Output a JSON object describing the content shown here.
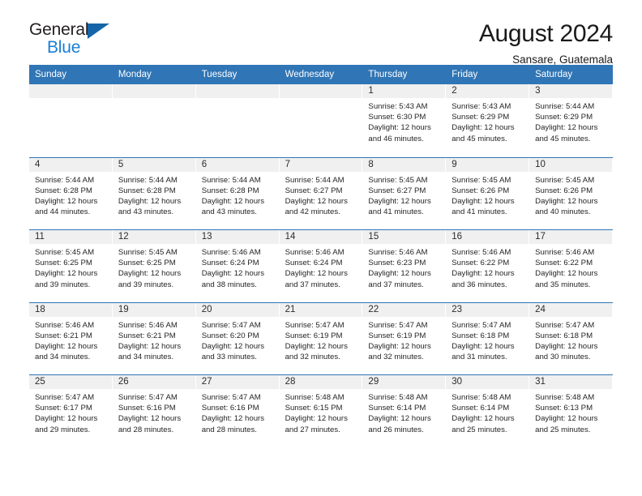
{
  "brand": {
    "name_top": "General",
    "name_bottom": "Blue",
    "accent_color": "#1b7fd4",
    "triangle_color": "#1565a8"
  },
  "header": {
    "title": "August 2024",
    "subtitle": "Sansare, Guatemala"
  },
  "theme": {
    "header_blue": "#3075b5",
    "date_strip_gray": "#f0f0f0",
    "text_color": "#252525"
  },
  "weekdays": [
    "Sunday",
    "Monday",
    "Tuesday",
    "Wednesday",
    "Thursday",
    "Friday",
    "Saturday"
  ],
  "labels": {
    "sunrise": "Sunrise:",
    "sunset": "Sunset:",
    "daylight": "Daylight:"
  },
  "weeks": [
    [
      {
        "day": "",
        "empty": true
      },
      {
        "day": "",
        "empty": true
      },
      {
        "day": "",
        "empty": true
      },
      {
        "day": "",
        "empty": true
      },
      {
        "day": "1",
        "sunrise": "Sunrise: 5:43 AM",
        "sunset": "Sunset: 6:30 PM",
        "daylight_1": "Daylight: 12 hours",
        "daylight_2": "and 46 minutes."
      },
      {
        "day": "2",
        "sunrise": "Sunrise: 5:43 AM",
        "sunset": "Sunset: 6:29 PM",
        "daylight_1": "Daylight: 12 hours",
        "daylight_2": "and 45 minutes."
      },
      {
        "day": "3",
        "sunrise": "Sunrise: 5:44 AM",
        "sunset": "Sunset: 6:29 PM",
        "daylight_1": "Daylight: 12 hours",
        "daylight_2": "and 45 minutes."
      }
    ],
    [
      {
        "day": "4",
        "sunrise": "Sunrise: 5:44 AM",
        "sunset": "Sunset: 6:28 PM",
        "daylight_1": "Daylight: 12 hours",
        "daylight_2": "and 44 minutes."
      },
      {
        "day": "5",
        "sunrise": "Sunrise: 5:44 AM",
        "sunset": "Sunset: 6:28 PM",
        "daylight_1": "Daylight: 12 hours",
        "daylight_2": "and 43 minutes."
      },
      {
        "day": "6",
        "sunrise": "Sunrise: 5:44 AM",
        "sunset": "Sunset: 6:28 PM",
        "daylight_1": "Daylight: 12 hours",
        "daylight_2": "and 43 minutes."
      },
      {
        "day": "7",
        "sunrise": "Sunrise: 5:44 AM",
        "sunset": "Sunset: 6:27 PM",
        "daylight_1": "Daylight: 12 hours",
        "daylight_2": "and 42 minutes."
      },
      {
        "day": "8",
        "sunrise": "Sunrise: 5:45 AM",
        "sunset": "Sunset: 6:27 PM",
        "daylight_1": "Daylight: 12 hours",
        "daylight_2": "and 41 minutes."
      },
      {
        "day": "9",
        "sunrise": "Sunrise: 5:45 AM",
        "sunset": "Sunset: 6:26 PM",
        "daylight_1": "Daylight: 12 hours",
        "daylight_2": "and 41 minutes."
      },
      {
        "day": "10",
        "sunrise": "Sunrise: 5:45 AM",
        "sunset": "Sunset: 6:26 PM",
        "daylight_1": "Daylight: 12 hours",
        "daylight_2": "and 40 minutes."
      }
    ],
    [
      {
        "day": "11",
        "sunrise": "Sunrise: 5:45 AM",
        "sunset": "Sunset: 6:25 PM",
        "daylight_1": "Daylight: 12 hours",
        "daylight_2": "and 39 minutes."
      },
      {
        "day": "12",
        "sunrise": "Sunrise: 5:45 AM",
        "sunset": "Sunset: 6:25 PM",
        "daylight_1": "Daylight: 12 hours",
        "daylight_2": "and 39 minutes."
      },
      {
        "day": "13",
        "sunrise": "Sunrise: 5:46 AM",
        "sunset": "Sunset: 6:24 PM",
        "daylight_1": "Daylight: 12 hours",
        "daylight_2": "and 38 minutes."
      },
      {
        "day": "14",
        "sunrise": "Sunrise: 5:46 AM",
        "sunset": "Sunset: 6:24 PM",
        "daylight_1": "Daylight: 12 hours",
        "daylight_2": "and 37 minutes."
      },
      {
        "day": "15",
        "sunrise": "Sunrise: 5:46 AM",
        "sunset": "Sunset: 6:23 PM",
        "daylight_1": "Daylight: 12 hours",
        "daylight_2": "and 37 minutes."
      },
      {
        "day": "16",
        "sunrise": "Sunrise: 5:46 AM",
        "sunset": "Sunset: 6:22 PM",
        "daylight_1": "Daylight: 12 hours",
        "daylight_2": "and 36 minutes."
      },
      {
        "day": "17",
        "sunrise": "Sunrise: 5:46 AM",
        "sunset": "Sunset: 6:22 PM",
        "daylight_1": "Daylight: 12 hours",
        "daylight_2": "and 35 minutes."
      }
    ],
    [
      {
        "day": "18",
        "sunrise": "Sunrise: 5:46 AM",
        "sunset": "Sunset: 6:21 PM",
        "daylight_1": "Daylight: 12 hours",
        "daylight_2": "and 34 minutes."
      },
      {
        "day": "19",
        "sunrise": "Sunrise: 5:46 AM",
        "sunset": "Sunset: 6:21 PM",
        "daylight_1": "Daylight: 12 hours",
        "daylight_2": "and 34 minutes."
      },
      {
        "day": "20",
        "sunrise": "Sunrise: 5:47 AM",
        "sunset": "Sunset: 6:20 PM",
        "daylight_1": "Daylight: 12 hours",
        "daylight_2": "and 33 minutes."
      },
      {
        "day": "21",
        "sunrise": "Sunrise: 5:47 AM",
        "sunset": "Sunset: 6:19 PM",
        "daylight_1": "Daylight: 12 hours",
        "daylight_2": "and 32 minutes."
      },
      {
        "day": "22",
        "sunrise": "Sunrise: 5:47 AM",
        "sunset": "Sunset: 6:19 PM",
        "daylight_1": "Daylight: 12 hours",
        "daylight_2": "and 32 minutes."
      },
      {
        "day": "23",
        "sunrise": "Sunrise: 5:47 AM",
        "sunset": "Sunset: 6:18 PM",
        "daylight_1": "Daylight: 12 hours",
        "daylight_2": "and 31 minutes."
      },
      {
        "day": "24",
        "sunrise": "Sunrise: 5:47 AM",
        "sunset": "Sunset: 6:18 PM",
        "daylight_1": "Daylight: 12 hours",
        "daylight_2": "and 30 minutes."
      }
    ],
    [
      {
        "day": "25",
        "sunrise": "Sunrise: 5:47 AM",
        "sunset": "Sunset: 6:17 PM",
        "daylight_1": "Daylight: 12 hours",
        "daylight_2": "and 29 minutes."
      },
      {
        "day": "26",
        "sunrise": "Sunrise: 5:47 AM",
        "sunset": "Sunset: 6:16 PM",
        "daylight_1": "Daylight: 12 hours",
        "daylight_2": "and 28 minutes."
      },
      {
        "day": "27",
        "sunrise": "Sunrise: 5:47 AM",
        "sunset": "Sunset: 6:16 PM",
        "daylight_1": "Daylight: 12 hours",
        "daylight_2": "and 28 minutes."
      },
      {
        "day": "28",
        "sunrise": "Sunrise: 5:48 AM",
        "sunset": "Sunset: 6:15 PM",
        "daylight_1": "Daylight: 12 hours",
        "daylight_2": "and 27 minutes."
      },
      {
        "day": "29",
        "sunrise": "Sunrise: 5:48 AM",
        "sunset": "Sunset: 6:14 PM",
        "daylight_1": "Daylight: 12 hours",
        "daylight_2": "and 26 minutes."
      },
      {
        "day": "30",
        "sunrise": "Sunrise: 5:48 AM",
        "sunset": "Sunset: 6:14 PM",
        "daylight_1": "Daylight: 12 hours",
        "daylight_2": "and 25 minutes."
      },
      {
        "day": "31",
        "sunrise": "Sunrise: 5:48 AM",
        "sunset": "Sunset: 6:13 PM",
        "daylight_1": "Daylight: 12 hours",
        "daylight_2": "and 25 minutes."
      }
    ]
  ]
}
